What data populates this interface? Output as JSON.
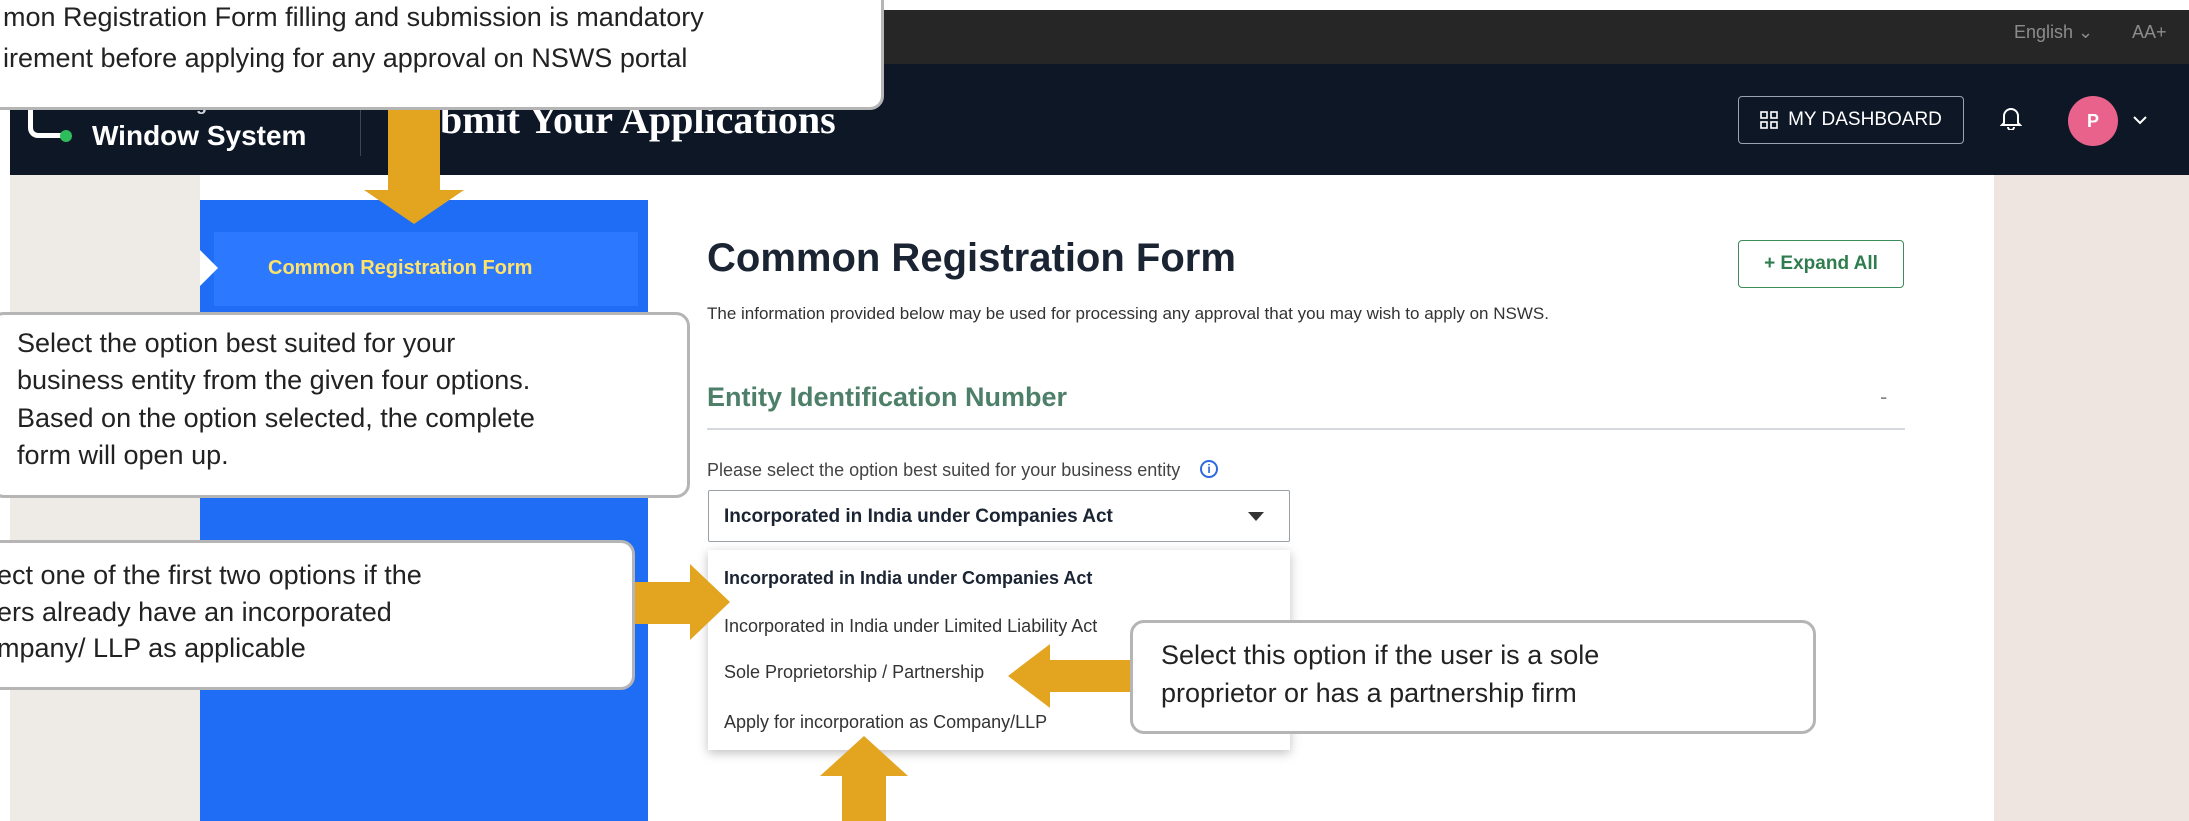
{
  "topbar": {
    "language": "English ⌄",
    "text_size": "AA+"
  },
  "header": {
    "logo_line1": "National Single",
    "logo_line2": "Window System",
    "page_title": "bmit Your Applications",
    "dashboard_label": "MY DASHBOARD",
    "avatar_initial": "P"
  },
  "sidebar": {
    "active_item": "Common Registration Form"
  },
  "main": {
    "title": "Common Registration Form",
    "description": "The information provided below may be used for processing any approval that you may wish to apply on NSWS.",
    "expand_all": "+  Expand All",
    "section_title": "Entity Identification Number",
    "section_toggle": "-",
    "select_label": "Please select the option best suited for your business entity",
    "select_value": "Incorporated in India under Companies Act",
    "options": [
      "Incorporated in India under Companies Act",
      "Incorporated in India under Limited Liability Act",
      "Sole Proprietorship / Partnership",
      "Apply for incorporation as Company/LLP"
    ]
  },
  "callouts": {
    "top": [
      "mon Registration Form filling and submission is mandatory",
      "irement before applying for any approval on NSWS portal"
    ],
    "entity": [
      "Select the option best suited for your",
      "business entity from the given four options.",
      "Based on the option selected, the complete",
      "form will open up."
    ],
    "first_two": [
      "ect one of the first two options if the",
      "ers already have an incorporated",
      "mpany/ LLP as applicable"
    ],
    "sole": [
      "Select this option if the user is a sole",
      "proprietor or has a partnership firm"
    ]
  },
  "colors": {
    "accent": "#e3a41f",
    "sidebar": "#1f6cf5",
    "header": "#0e1726",
    "section": "#4e7f68"
  }
}
